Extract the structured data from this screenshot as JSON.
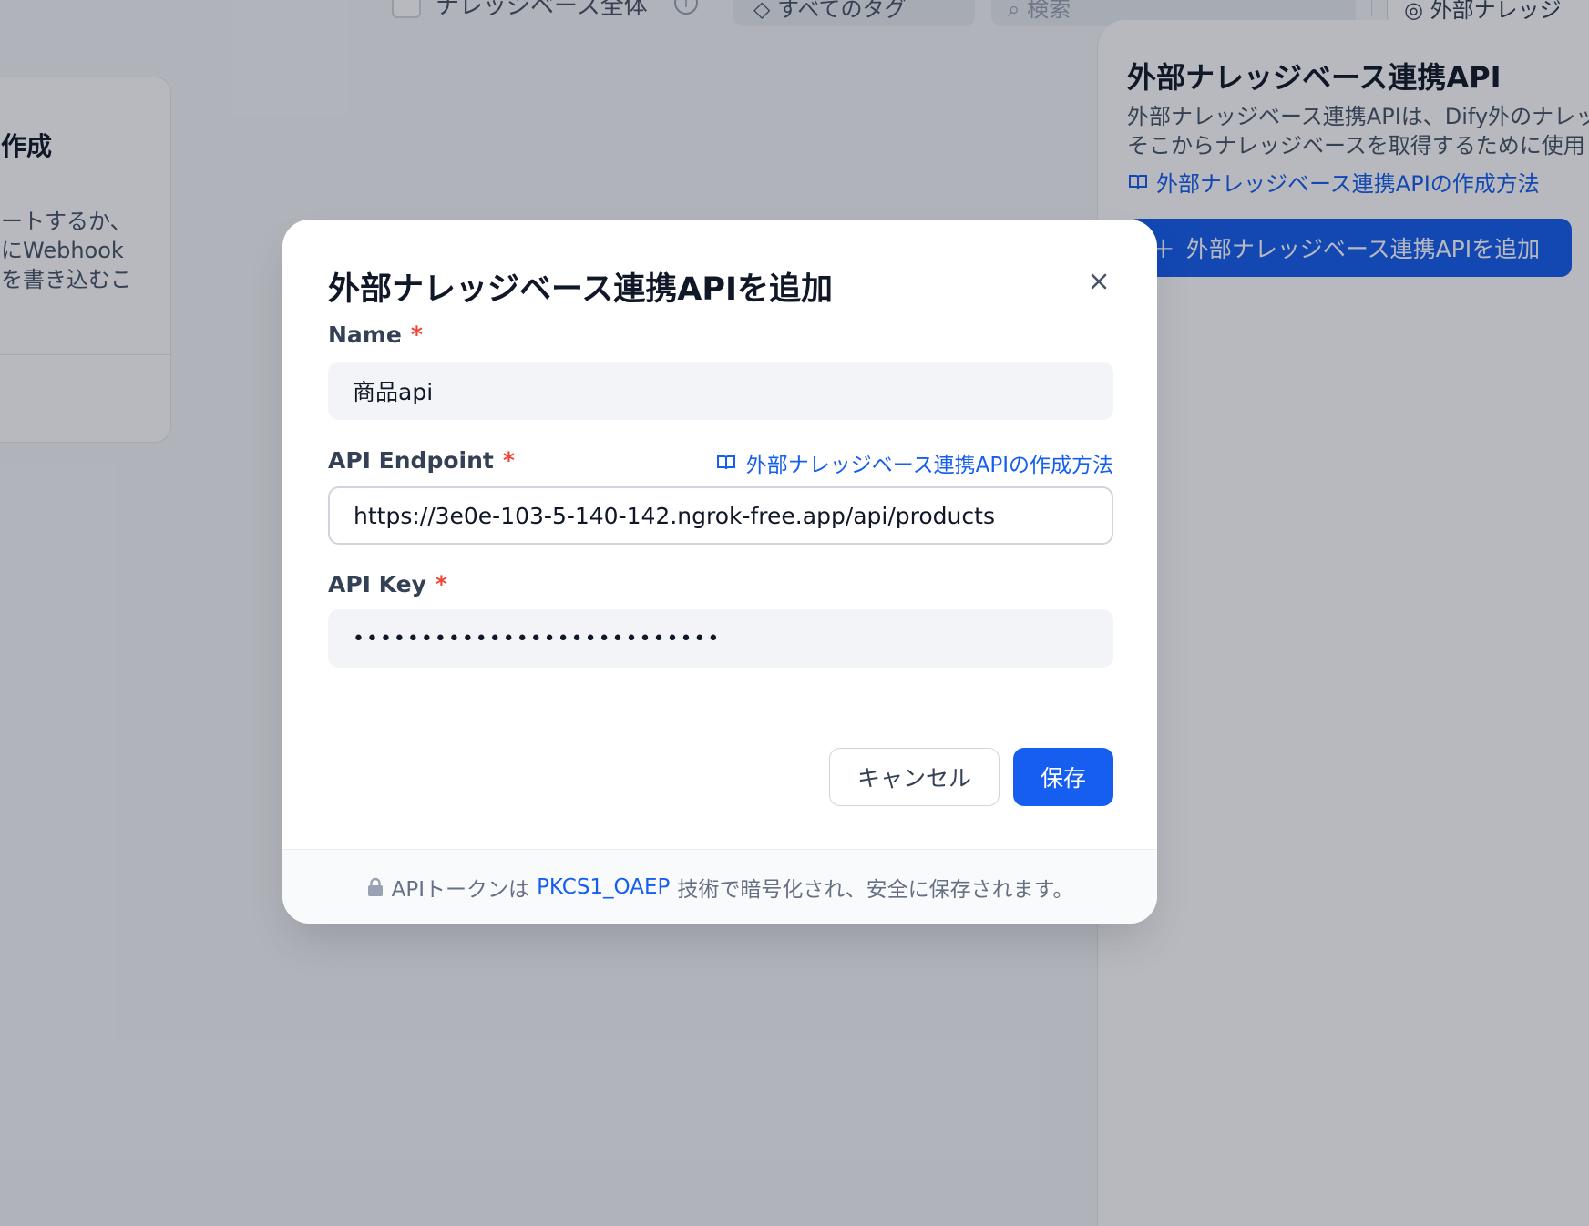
{
  "background": {
    "top_bar": {
      "checkbox_label": "ナレッジベース全体",
      "tags_label": "すべてのタグ",
      "search_placeholder": "検索",
      "external_button_label": "外部ナレッジ"
    },
    "card": {
      "title": "作成",
      "description": "ートするか、\nにWebhook\nを書き込むこ"
    },
    "side_panel": {
      "title": "外部ナレッジベース連携API",
      "description": "外部ナレッジベース連携APIは、Dify外のナレッジベースと連携し、\nそこからナレッジベースを取得するために使用します。",
      "doc_link": "外部ナレッジベース連携APIの作成方法",
      "add_button": "外部ナレッジベース連携APIを追加"
    }
  },
  "modal": {
    "title": "外部ナレッジベース連携APIを追加",
    "fields": {
      "name": {
        "label": "Name",
        "value": "商品api"
      },
      "endpoint": {
        "label": "API Endpoint",
        "value": "https://3e0e-103-5-140-142.ngrok-free.app/api/products",
        "doc_link": "外部ナレッジベース連携APIの作成方法"
      },
      "api_key": {
        "label": "API Key",
        "value": "•••••••••••••••••••••••••••"
      }
    },
    "required_mark": "*",
    "buttons": {
      "cancel": "キャンセル",
      "save": "保存"
    },
    "footer": {
      "prefix": "APIトークンは",
      "method": "PKCS1_OAEP",
      "suffix": "技術で暗号化され、安全に保存されます。"
    }
  },
  "colors": {
    "accent": "#155eef",
    "required": "#f04438",
    "overlay": "rgba(16,24,40,0.30)"
  }
}
